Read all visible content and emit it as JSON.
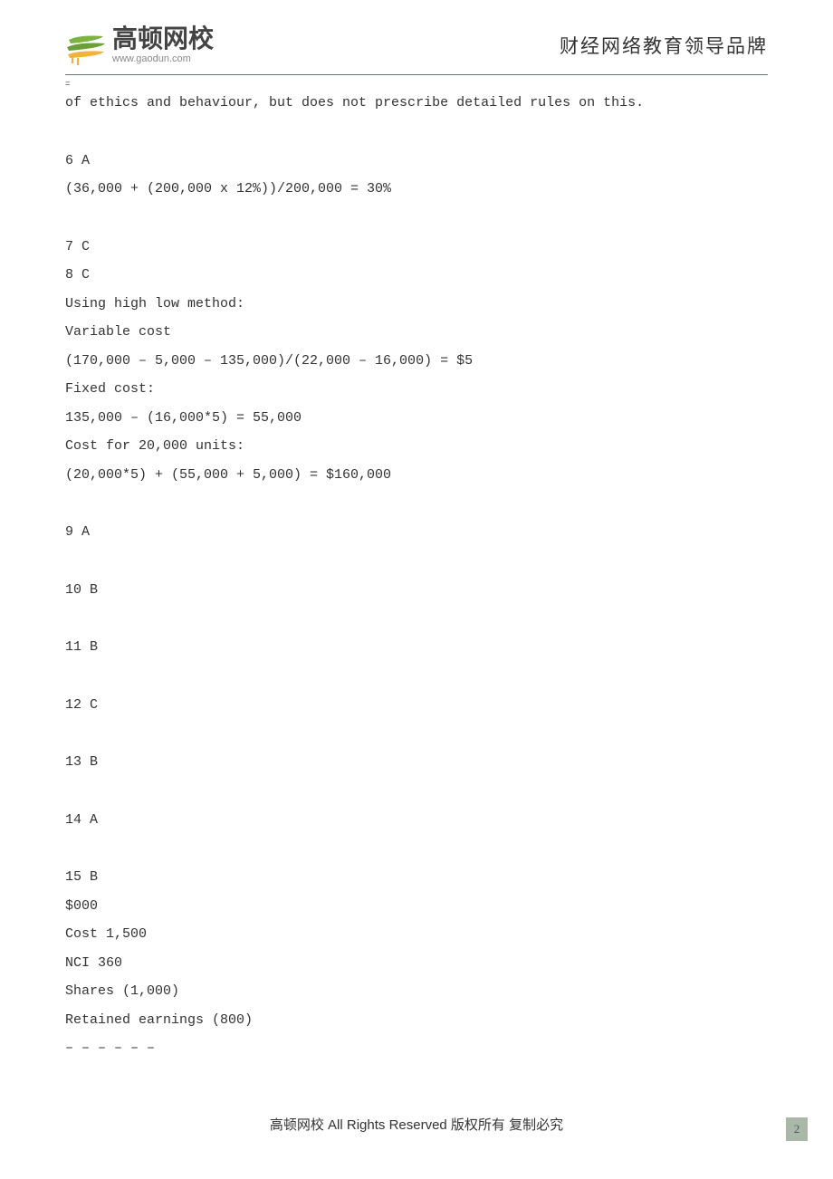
{
  "header": {
    "logo_cn": "高顿网校",
    "logo_url": "www.gaodun.com",
    "tagline": "财经网络教育领导品牌"
  },
  "content": {
    "small_mark": "=",
    "line_top": "of ethics and behaviour, but does not prescribe detailed rules on this.",
    "q6_header": "6 A",
    "q6_calc": "(36,000 + (200,000 x 12%))/200,000 = 30%",
    "q7": "7 C",
    "q8": "8 C",
    "q8_method": "Using high low method:",
    "q8_varcost_lbl": "Variable cost",
    "q8_varcost_calc": "(170,000 – 5,000 – 135,000)/(22,000 – 16,000) = $5",
    "q8_fixedcost_lbl": "Fixed cost:",
    "q8_fixedcost_calc": "135,000 – (16,000*5) = 55,000",
    "q8_cost20k_lbl": "Cost for 20,000 units:",
    "q8_cost20k_calc": "(20,000*5) + (55,000 + 5,000) = $160,000",
    "q9": "9 A",
    "q10": "10 B",
    "q11": "11 B",
    "q12": "12 C",
    "q13": "13 B",
    "q14": "14 A",
    "q15": "15 B",
    "q15_000": "$000",
    "q15_cost": "Cost 1,500",
    "q15_nci": "NCI 360",
    "q15_shares": "Shares (1,000)",
    "q15_re": "Retained earnings (800)",
    "q15_dashes": "– – – – – –"
  },
  "footer": {
    "text_prefix": "高顿网校 ",
    "rights": "All Rights Reserved",
    "text_suffix": "  版权所有 复制必究"
  },
  "page_number": "2"
}
